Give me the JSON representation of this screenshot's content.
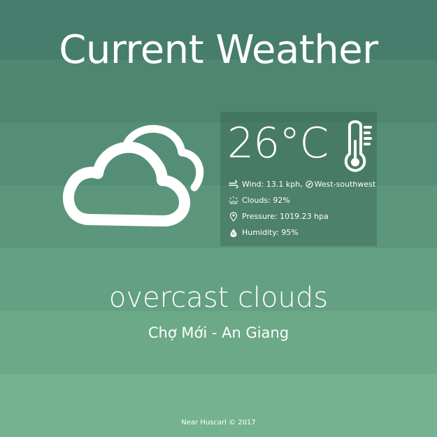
{
  "page": {
    "title": "Current Weather",
    "background_bands": [
      "#467d6c",
      "#4e8672",
      "#558e77",
      "#5c967d",
      "#64a083",
      "#6ba989",
      "#75b38e"
    ]
  },
  "weather": {
    "icon": "cloud-icon",
    "temperature": "26°C",
    "temperature_icon": "thermometer-icon",
    "details": {
      "wind_label": "Wind: 13.1 kph,",
      "wind_direction": "West-southwest",
      "clouds": "Clouds: 92%",
      "pressure": "Pressure: 1019.23 hpa",
      "humidity": "Humidity: 95%"
    },
    "description": "overcast clouds",
    "location": "Chợ Mới - An Giang"
  },
  "footer": {
    "text": "Near Huscarl © 2017"
  }
}
